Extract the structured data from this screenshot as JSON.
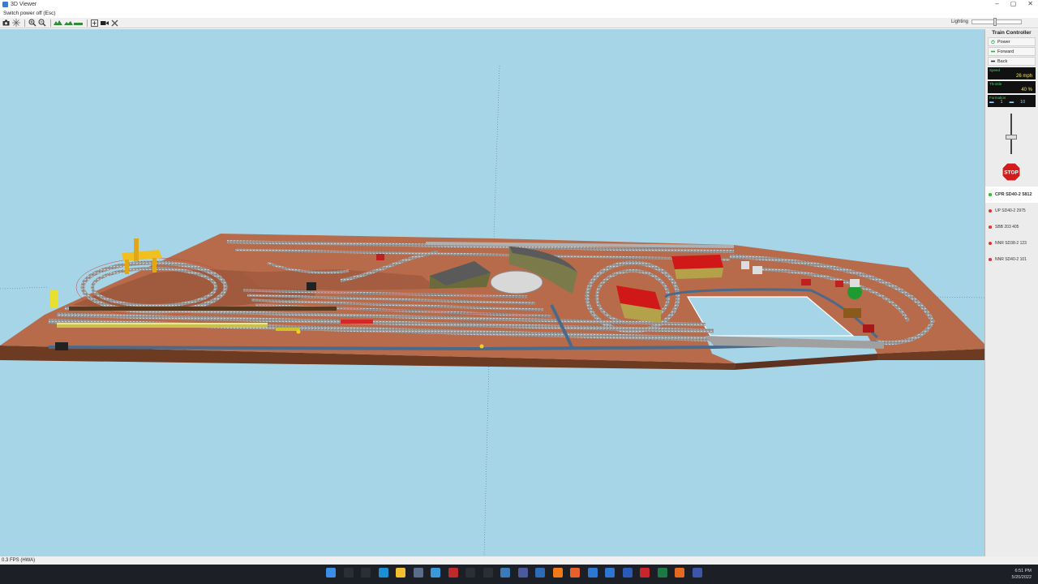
{
  "window": {
    "title": "3D Viewer",
    "menu": "Switch power off (Esc)",
    "min": "–",
    "max": "▢",
    "close": "✕"
  },
  "toolbar": {
    "lighting_label": "Lighting",
    "lighting_level": 0.45,
    "icons": [
      "camera-icon",
      "compass-icon",
      "zoom-in-icon",
      "zoom-out-icon",
      "terrain-view-1-icon",
      "terrain-view-2-icon",
      "terrain-view-3-icon",
      "fit-icon",
      "video-icon",
      "settings-icon"
    ]
  },
  "status": {
    "fps": "0.3 FPS (HWA)"
  },
  "panel": {
    "header": "Train Controller",
    "buttons": [
      {
        "label": "Power",
        "icon": "power-icon",
        "color": "#2fb34a"
      },
      {
        "label": "Forward",
        "icon": "forward-icon",
        "color": "#2fb34a"
      },
      {
        "label": "Back",
        "icon": "back-icon",
        "color": "#333333"
      }
    ],
    "speed_label": "Speed",
    "speed_value": "26 mph",
    "throttle_label": "Throttle",
    "throttle_value": "40 %",
    "formation_label": "Formation",
    "formation_locos": "1",
    "formation_cars": "10",
    "throttle_level": 0.4,
    "stop_label": "STOP"
  },
  "locos": [
    {
      "name": "CPR SD40-2 5812",
      "color": "#22c222",
      "active": true
    },
    {
      "name": "UP SD40-2 2975",
      "color": "#e23232",
      "active": false
    },
    {
      "name": "SBB 203 405",
      "color": "#e23232",
      "active": false
    },
    {
      "name": "NNR SD38-2 123",
      "color": "#e23232",
      "active": false
    },
    {
      "name": "NNR SD40-2 101",
      "color": "#e23232",
      "active": false
    }
  ],
  "taskbar": {
    "time": "6:51 PM",
    "date": "5/20/2022",
    "apps": [
      {
        "icon": "windows-start-icon",
        "color": "#3b8ee8"
      },
      {
        "icon": "search-icon",
        "color": "#2a2e36"
      },
      {
        "icon": "task-view-icon",
        "color": "#2a2e36"
      },
      {
        "icon": "edge-icon",
        "color": "#1a8fd6"
      },
      {
        "icon": "file-explorer-icon",
        "color": "#f0c030"
      },
      {
        "icon": "calculator-icon",
        "color": "#5b6b8a"
      },
      {
        "icon": "app-blue-icon",
        "color": "#3a9ad9"
      },
      {
        "icon": "app-red-icon",
        "color": "#c2292e"
      },
      {
        "icon": "app-q-icon",
        "color": "#2a2e36"
      },
      {
        "icon": "app-square-icon",
        "color": "#2a2e36"
      },
      {
        "icon": "app-teal-icon",
        "color": "#3a7ab8"
      },
      {
        "icon": "app-circle-icon",
        "color": "#4a5a9a"
      },
      {
        "icon": "app-doc-icon",
        "color": "#2d6bb5"
      },
      {
        "icon": "vlc-icon",
        "color": "#f07b16"
      },
      {
        "icon": "app-orange-icon",
        "color": "#e8602c"
      },
      {
        "icon": "mail-icon",
        "color": "#2d79d1"
      },
      {
        "icon": "todo-icon",
        "color": "#2f76d0"
      },
      {
        "icon": "word-icon",
        "color": "#2b5bb8"
      },
      {
        "icon": "acrobat-icon",
        "color": "#c9252c"
      },
      {
        "icon": "excel-icon",
        "color": "#1e7a44"
      },
      {
        "icon": "firefox-icon",
        "color": "#e66a1d"
      },
      {
        "icon": "train-app-icon",
        "color": "#3c57a8"
      }
    ]
  }
}
